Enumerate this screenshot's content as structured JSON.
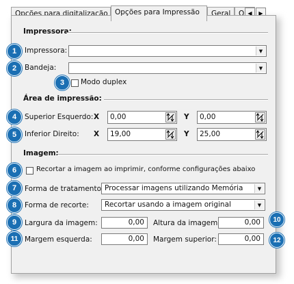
{
  "tabs": [
    {
      "label": "Opções para digitalização",
      "active": false
    },
    {
      "label": "Opções para Impressão",
      "active": true
    },
    {
      "label": "Geral",
      "active": false
    },
    {
      "label": "Opç",
      "active": false
    }
  ],
  "printer_group": {
    "title": "Impressora:",
    "printer_label": "Impressora:",
    "printer_value": "",
    "tray_label": "Bandeja:",
    "tray_value": "",
    "duplex_label": "Modo duplex",
    "duplex_checked": false
  },
  "area_group": {
    "title": "Área de impressão:",
    "top_left_label": "Superior Esquerdo:",
    "bottom_right_label": "Inferior Direito:",
    "x_label": "X",
    "y_label": "Y",
    "top_left_x": "0,00",
    "top_left_y": "0,00",
    "bottom_right_x": "19,00",
    "bottom_right_y": "25,00"
  },
  "image_group": {
    "title": "Imagem:",
    "crop_checkbox_label": "Recortar a imagem ao imprimir, conforme configurações abaixo",
    "crop_checked": false,
    "treatment_label": "Forma de tratamento:",
    "treatment_value": "Processar imagens utilizando Memória",
    "crop_mode_label": "Forma de recorte:",
    "crop_mode_value": "Recortar usando a imagem original",
    "width_label": "Largura da imagem:",
    "width_value": "0,00",
    "height_label": "Altura da imagem:",
    "height_value": "0,00",
    "left_margin_label": "Margem esquerda:",
    "left_margin_value": "0,00",
    "top_margin_label": "Margem superior:",
    "top_margin_value": "0,00"
  },
  "callouts": [
    "1",
    "2",
    "3",
    "4",
    "5",
    "6",
    "7",
    "8",
    "9",
    "10",
    "11",
    "12"
  ],
  "colors": {
    "callout": "#1b6fb3",
    "dialog_bg": "#f0f0f0"
  }
}
